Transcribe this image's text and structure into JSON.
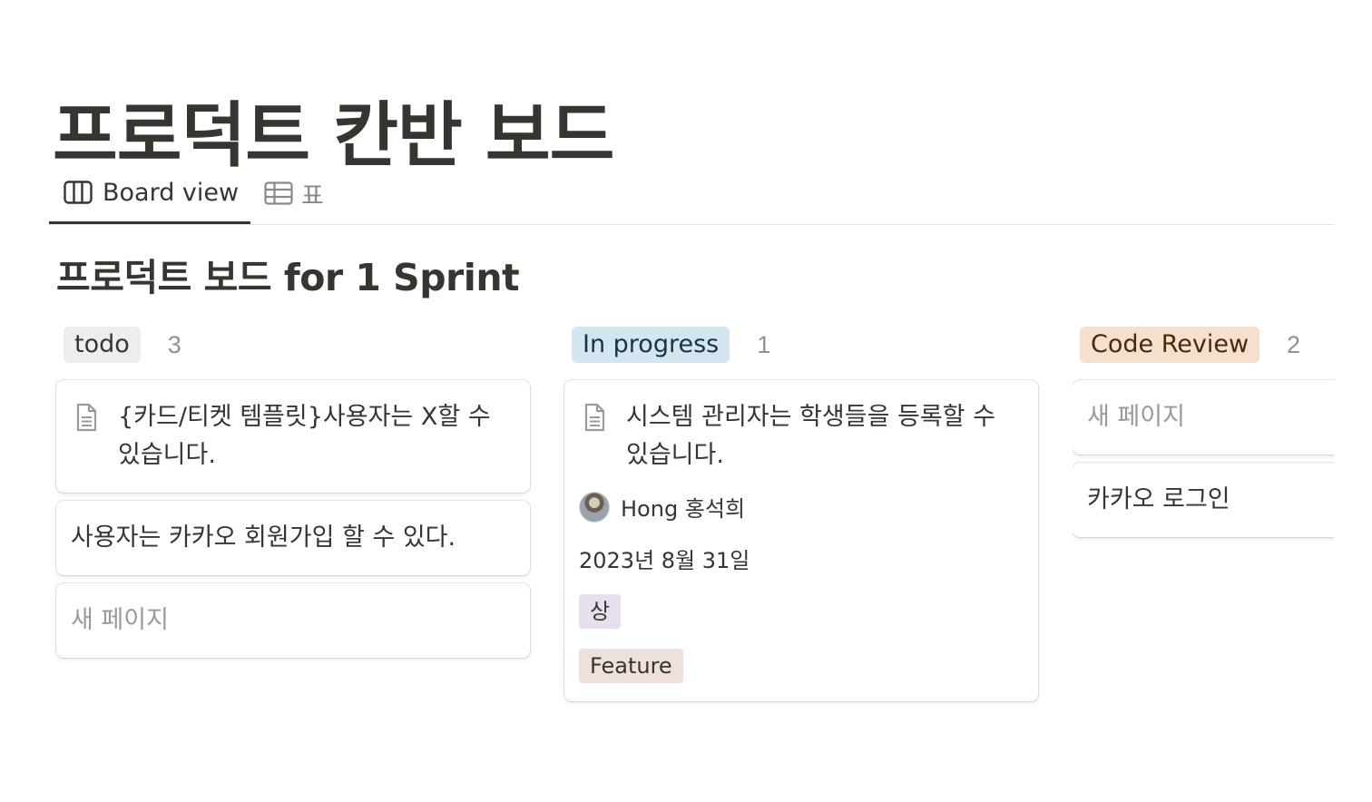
{
  "page": {
    "title": "프로덕트 칸반 보드"
  },
  "views": {
    "tabs": [
      {
        "label": "Board view",
        "icon": "board-columns-icon",
        "active": true
      },
      {
        "label": "표",
        "icon": "table-icon",
        "active": false
      }
    ]
  },
  "board": {
    "title": "프로덕트 보드 for 1 Sprint",
    "columns": [
      {
        "status": "todo",
        "count": "3",
        "pill_bg": "#ededec",
        "pill_color": "#37352f",
        "cards": [
          {
            "title": "{카드/티켓 템플릿}사용자는 X할 수 있습니다.",
            "icon": "document-icon"
          },
          {
            "title": "사용자는 카카오 회원가입 할 수 있다."
          },
          {
            "title": "새 페이지",
            "placeholder": true
          }
        ]
      },
      {
        "status": "In progress",
        "count": "1",
        "pill_bg": "#d3e5ef",
        "pill_color": "#183347",
        "cards": [
          {
            "title": "시스템 관리자는 학생들을 등록할 수 있습니다.",
            "icon": "document-icon",
            "assignee": "Hong 홍석희",
            "date": "2023년 8월 31일",
            "priority": {
              "label": "상",
              "bg": "#e8deee"
            },
            "type": {
              "label": "Feature",
              "bg": "#eee0da"
            }
          }
        ]
      },
      {
        "status": "Code Review",
        "count": "2",
        "pill_bg": "#f5e0cd",
        "pill_color": "#49290e",
        "cards": [
          {
            "title": "새 페이지",
            "placeholder": true
          },
          {
            "title": "카카오 로그인"
          }
        ]
      }
    ]
  }
}
